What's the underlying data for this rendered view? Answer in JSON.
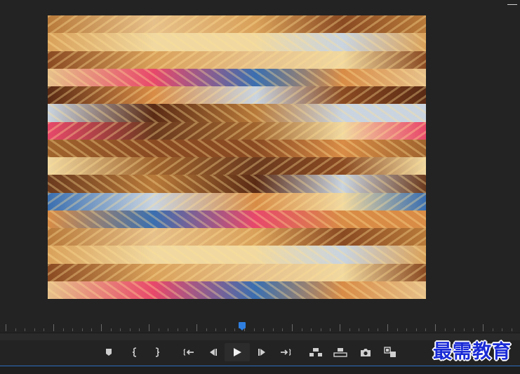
{
  "program_monitor": {
    "frame": {
      "description_icon": "video-frame",
      "strip_count": 16,
      "palette": [
        "#b87a3a",
        "#d9a15a",
        "#8a4a22",
        "#e6c08a",
        "#5a2a14",
        "#c9d4e0",
        "#e8486a",
        "#a0642e",
        "#f0d8a0",
        "#6b3a1e",
        "#3a6fb0",
        "#d88c46"
      ]
    }
  },
  "transport": {
    "buttons": [
      {
        "name": "add-marker-button",
        "icon": "marker-icon"
      },
      {
        "name": "mark-in-button",
        "icon": "mark-in-icon"
      },
      {
        "name": "mark-out-button",
        "icon": "mark-out-icon"
      },
      {
        "name": "go-to-in-button",
        "icon": "go-to-in-icon"
      },
      {
        "name": "step-back-button",
        "icon": "step-back-icon"
      },
      {
        "name": "play-button",
        "icon": "play-icon"
      },
      {
        "name": "step-forward-button",
        "icon": "step-forward-icon"
      },
      {
        "name": "go-to-out-button",
        "icon": "go-to-out-icon"
      },
      {
        "name": "lift-button",
        "icon": "lift-icon"
      },
      {
        "name": "extract-button",
        "icon": "extract-icon"
      },
      {
        "name": "export-frame-button",
        "icon": "camera-icon"
      },
      {
        "name": "comparison-view-button",
        "icon": "comparison-view-icon"
      }
    ]
  },
  "colors": {
    "accent": "#2f7fe0",
    "panel_bg": "#232323"
  },
  "watermark": {
    "text": "最需教育"
  }
}
